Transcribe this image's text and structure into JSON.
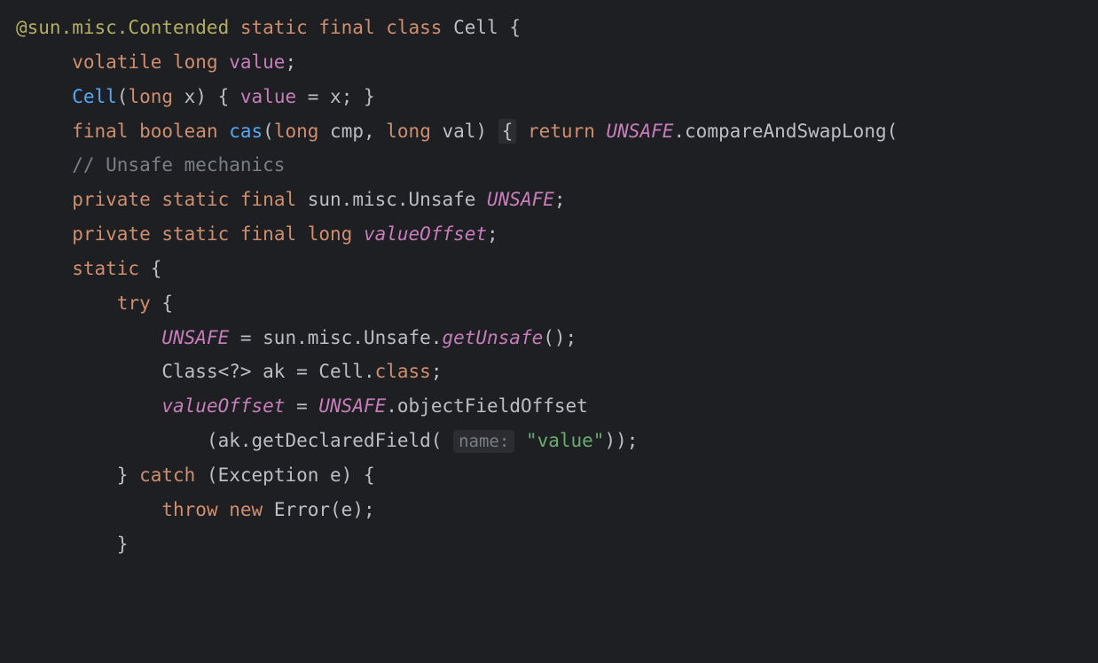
{
  "code": {
    "l1": {
      "annotation": "@sun.misc.Contended",
      "kw_static": " static",
      "kw_final": " final",
      "kw_class": " class",
      "classname": " Cell",
      "brace": " {"
    },
    "l2": {
      "indent": "     ",
      "kw_volatile": "volatile",
      "kw_long": " long",
      "field": " value",
      "semi": ";"
    },
    "l3": {
      "indent": "     ",
      "ctor": "Cell",
      "lparen": "(",
      "kw_long": "long",
      "param": " x",
      "rparen_brace": ") { ",
      "field": "value",
      "eq": " = x; }"
    },
    "l4": {
      "indent": "     ",
      "kw_final": "final",
      "kw_boolean": " boolean",
      "method": " cas",
      "lparen": "(",
      "kw_long1": "long",
      "p1": " cmp, ",
      "kw_long2": "long",
      "p2": " val) ",
      "dimbrace": "{",
      "kw_return": " return",
      "unsafe": " UNSAFE",
      "call": ".compareAndSwapLong("
    },
    "l5": {
      "blank": ""
    },
    "l6": {
      "indent": "     ",
      "comment": "// Unsafe mechanics"
    },
    "l7": {
      "indent": "     ",
      "kw_private": "private",
      "kw_static": " static",
      "kw_final": " final",
      "type": " sun.misc.Unsafe",
      "field": " UNSAFE",
      "semi": ";"
    },
    "l8": {
      "indent": "     ",
      "kw_private": "private",
      "kw_static": " static",
      "kw_final": " final",
      "kw_long": " long",
      "field": " valueOffset",
      "semi": ";"
    },
    "l9": {
      "indent": "     ",
      "kw_static": "static",
      "brace": " {"
    },
    "l10": {
      "indent": "         ",
      "kw_try": "try",
      "brace": " {"
    },
    "l11": {
      "indent": "             ",
      "field": "UNSAFE",
      "eq": " = sun.misc.Unsafe.",
      "method": "getUnsafe",
      "tail": "();"
    },
    "l12": {
      "indent": "             ",
      "type": "Class<?> ak = Cell.",
      "kw_class": "class",
      "semi": ";"
    },
    "l13": {
      "indent": "             ",
      "field": "valueOffset",
      "eq": " = ",
      "unsafe": "UNSAFE",
      "call": ".objectFieldOffset"
    },
    "l14": {
      "indent": "                 ",
      "open": "(ak.getDeclaredField( ",
      "hint": "name:",
      "str": " \"value\"",
      "close": "));"
    },
    "l15": {
      "indent": "         ",
      "rbrace": "} ",
      "kw_catch": "catch",
      "paren": " (Exception e) {"
    },
    "l16": {
      "indent": "             ",
      "kw_throw": "throw",
      "kw_new": " new",
      "call": " Error(e);"
    },
    "l17": {
      "indent": "         ",
      "rbrace": "}"
    }
  }
}
